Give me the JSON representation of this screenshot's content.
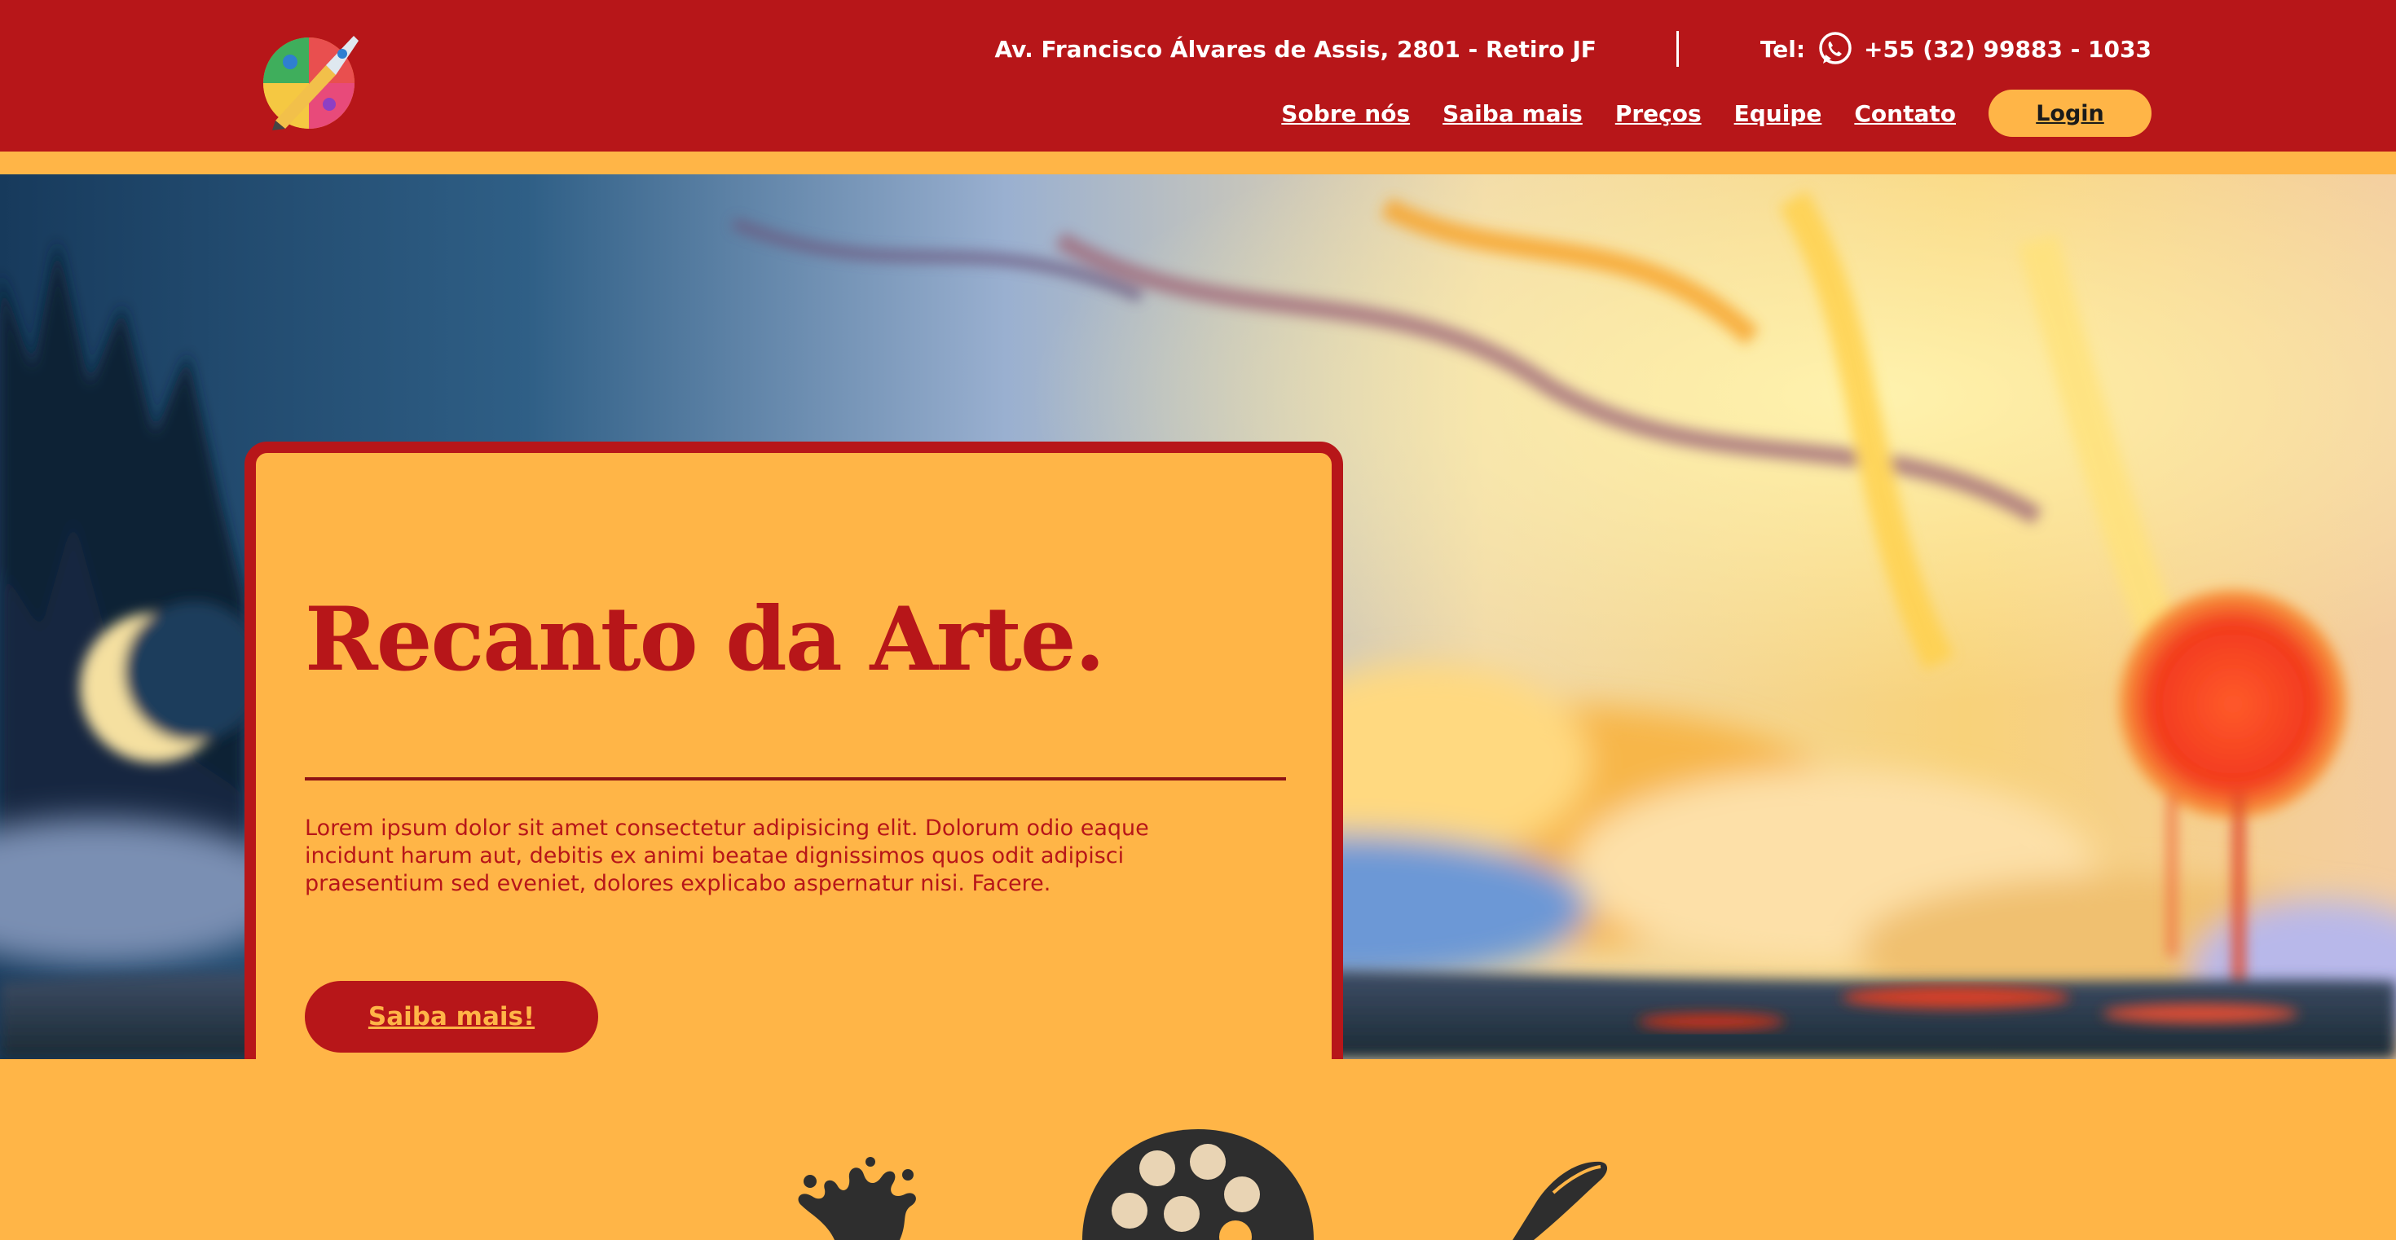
{
  "header": {
    "address": "Av. Francisco Álvares de Assis, 2801 - Retiro JF",
    "tel_label": "Tel:",
    "phone": "+55 (32) 99883 - 1033",
    "icons": {
      "logo": "palette-pen-logo",
      "phone": "whatsapp-icon"
    }
  },
  "nav": {
    "items": [
      "Sobre nós",
      "Saiba mais",
      "Preços",
      "Equipe",
      "Contato"
    ],
    "login": "Login"
  },
  "hero": {
    "title": "Recanto da Arte.",
    "text": "Lorem ipsum dolor sit amet consectetur adipisicing elit. Dolorum odio eaque incidunt harum aut, debitis ex animi beatae dignissimos quos odit adipisci praesentium sed eveniet, dolores explicabo aspernatur nisi. Facere.",
    "cta": "Saiba mais!",
    "background": "surreal-painting-landscape"
  },
  "features": {
    "icons": [
      "ink-splash-icon",
      "palette-icon",
      "fountain-pen-icon"
    ]
  },
  "colors": {
    "primary_red": "#b71619",
    "accent_yellow": "#ffb547",
    "dark_icon": "#2e2e2e"
  }
}
